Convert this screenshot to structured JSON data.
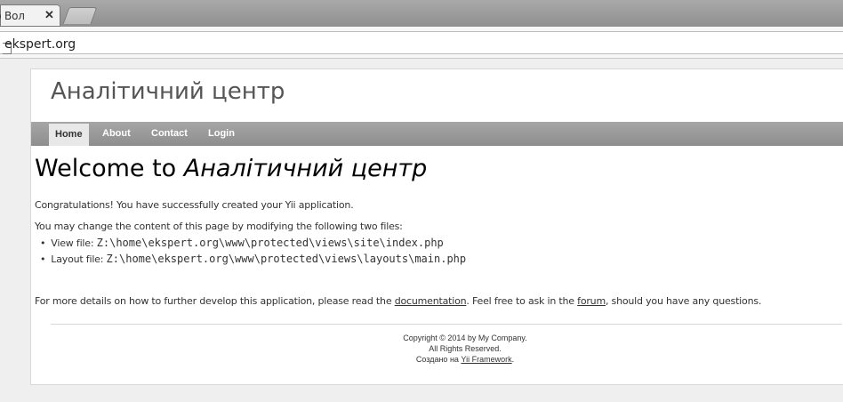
{
  "browser": {
    "tab_title": "р Вол",
    "tab_close": "✕",
    "url": "ekspert.org"
  },
  "site": {
    "logo": "Аналітичний центр",
    "menu": [
      {
        "label": "Home",
        "active": true
      },
      {
        "label": "About"
      },
      {
        "label": "Contact"
      },
      {
        "label": "Login"
      }
    ]
  },
  "content": {
    "welcome_prefix": "Welcome to ",
    "welcome_name": "Аналітичний центр",
    "congrats": "Congratulations! You have successfully created your Yii application.",
    "change_text": "You may change the content of this page by modifying the following two files:",
    "files": [
      {
        "label": "View file: ",
        "path": "Z:\\home\\ekspert.org\\www\\protected\\views\\site\\index.php"
      },
      {
        "label": "Layout file: ",
        "path": "Z:\\home\\ekspert.org\\www\\protected\\views\\layouts\\main.php"
      }
    ],
    "details_1": "For more details on how to further develop this application, please read the ",
    "doc_link": "documentation",
    "details_2": ". Feel free to ask in the ",
    "forum_link": "forum",
    "details_3": ", should you have any questions."
  },
  "footer": {
    "copyright": "Copyright © 2014 by My Company.",
    "rights": "All Rights Reserved.",
    "made_prefix": "Создано на ",
    "framework_link": "Yii Framework",
    "made_suffix": "."
  }
}
